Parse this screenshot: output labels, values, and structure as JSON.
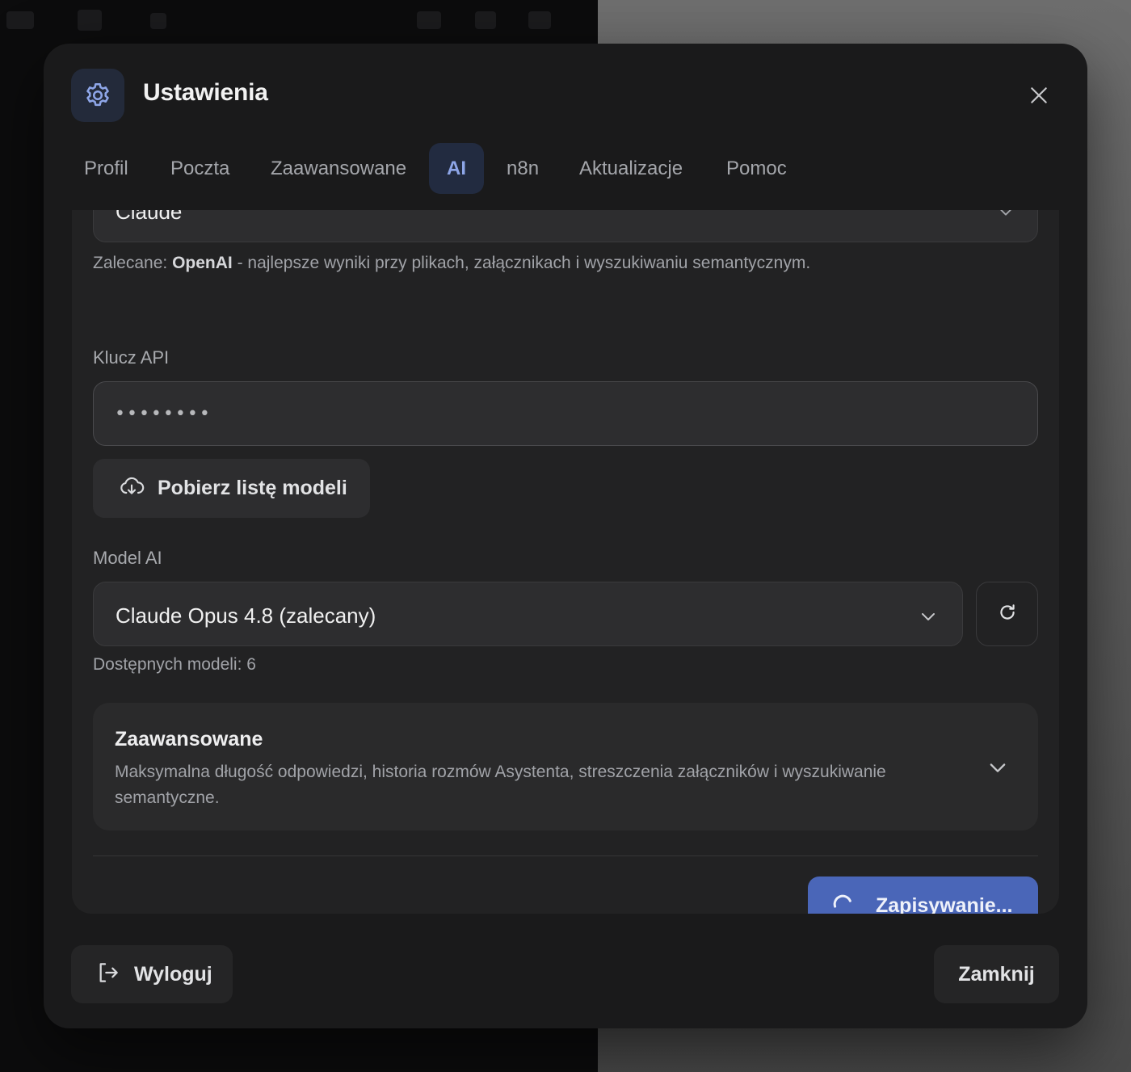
{
  "modal": {
    "title": "Ustawienia",
    "header_icon": "gear-icon",
    "close_icon": "close-icon"
  },
  "tabs": [
    {
      "label": "Profil",
      "active": false
    },
    {
      "label": "Poczta",
      "active": false
    },
    {
      "label": "Zaawansowane",
      "active": false
    },
    {
      "label": "AI",
      "active": true
    },
    {
      "label": "n8n",
      "active": false
    },
    {
      "label": "Aktualizacje",
      "active": false
    },
    {
      "label": "Pomoc",
      "active": false
    }
  ],
  "provider": {
    "selected": "Claude",
    "hint_prefix": "Zalecane: ",
    "hint_bold": "OpenAI",
    "hint_suffix": " - najlepsze wyniki przy plikach, załącznikach i wyszukiwaniu semantycznym."
  },
  "api_key": {
    "label": "Klucz API",
    "value": "••••••••"
  },
  "fetch_models": {
    "label": "Pobierz listę modeli",
    "icon": "cloud-download-icon"
  },
  "model": {
    "label": "Model AI",
    "selected": "Claude Opus 4.8 (zalecany)",
    "count_text": "Dostępnych modeli: 6",
    "refresh_icon": "refresh-icon"
  },
  "advanced": {
    "title": "Zaawansowane",
    "description": "Maksymalna długość odpowiedzi, historia rozmów Asystenta, streszczenia załączników i wyszukiwanie semantyczne."
  },
  "save": {
    "label": "Zapisywanie...",
    "icon": "spinner-icon"
  },
  "footer": {
    "logout_label": "Wyloguj",
    "logout_icon": "logout-icon",
    "close_label": "Zamknij"
  },
  "colors": {
    "accent": "#4a66b8",
    "active_tab_bg": "#222b40",
    "active_tab_text": "#8ea6e8",
    "modal_bg": "#1a1a1b"
  }
}
